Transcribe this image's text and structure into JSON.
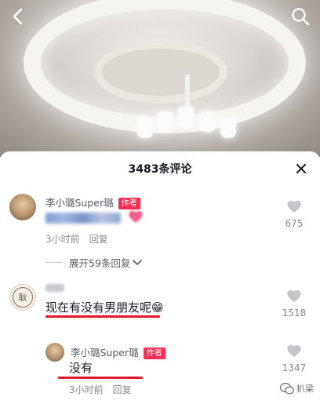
{
  "header": {
    "back_icon": "chevron-left-icon",
    "search_icon": "search-icon"
  },
  "sheet": {
    "title": "3483条评论",
    "close_icon": "close-icon"
  },
  "comments": [
    {
      "username": "李小璐Super璐",
      "badge": "作者",
      "text_blurred": true,
      "time": "3小时前",
      "reply_label": "回复",
      "likes": "675",
      "expand_label": "展开59条回复"
    },
    {
      "username_blurred": true,
      "avatar_text": "耿",
      "text": "现在有没有男朋友呢😁",
      "likes": "1518"
    },
    {
      "username": "李小璐Super璐",
      "badge": "作者",
      "text": "没有",
      "time": "3小时前",
      "reply_label": "回复",
      "likes": "1347"
    }
  ],
  "watermark": {
    "text": "扒梁"
  },
  "colors": {
    "accent": "#fe2c55",
    "underline": "#e5182b"
  }
}
